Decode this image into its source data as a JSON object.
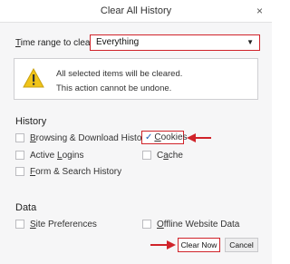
{
  "window": {
    "title": "Clear All History",
    "close_glyph": "×"
  },
  "range": {
    "label_prefix": "T",
    "label_rest": "ime range to clear:",
    "selected": "Everything",
    "arrow_glyph": "▼"
  },
  "warning": {
    "line1": "All selected items will be cleared.",
    "line2": "This action cannot be undone."
  },
  "history": {
    "title": "History",
    "items": {
      "browsing": {
        "pre": "",
        "accel": "B",
        "post": "rowsing & Download History",
        "checked": false
      },
      "cookies": {
        "pre": "",
        "accel": "C",
        "post": "ookies",
        "checked": true
      },
      "logins": {
        "pre": "Active ",
        "accel": "L",
        "post": "ogins",
        "checked": false
      },
      "cache": {
        "pre": "C",
        "accel": "a",
        "post": "che",
        "checked": false
      },
      "forms": {
        "pre": "",
        "accel": "F",
        "post": "orm & Search History",
        "checked": false
      }
    },
    "check_glyph": "✓"
  },
  "data": {
    "title": "Data",
    "items": {
      "site_prefs": {
        "pre": "",
        "accel": "S",
        "post": "ite Preferences",
        "checked": false
      },
      "offline": {
        "pre": "",
        "accel": "O",
        "post": "ffline Website Data",
        "checked": false
      }
    }
  },
  "buttons": {
    "clear_now": "Clear Now",
    "cancel": "Cancel"
  },
  "colors": {
    "highlight_red": "#d0232a",
    "check_blue": "#1e5fb5",
    "warning_yellow": "#f0c419"
  }
}
